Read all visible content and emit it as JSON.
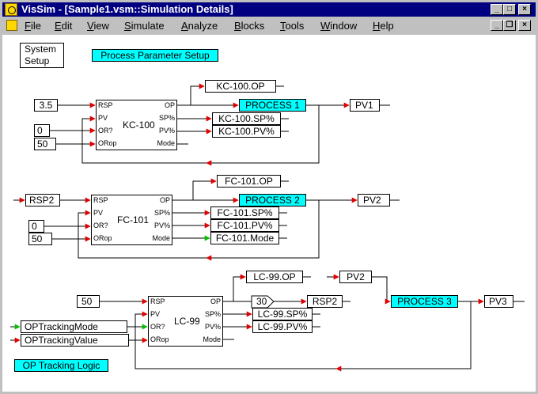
{
  "window": {
    "title": "VisSim - [Sample1.vsm::Simulation Details]",
    "min_glyph": "_",
    "max_glyph": "□",
    "close_glyph": "×",
    "restore_glyph": "❐"
  },
  "menu": [
    "File",
    "Edit",
    "View",
    "Simulate",
    "Analyze",
    "Blocks",
    "Tools",
    "Window",
    "Help"
  ],
  "canvas": {
    "system_setup": "System Setup",
    "process_parameter_setup": "Process Parameter Setup",
    "op_tracking_logic": "OP Tracking Logic",
    "loop1": {
      "rsp_value": "3.5",
      "pv_value": "0",
      "orop_value": "50",
      "block_name": "KC-100",
      "in_ports": [
        "RSP",
        "PV",
        "OR?",
        "ORop"
      ],
      "out_ports": [
        "OP",
        "SP%",
        "PV%",
        "Mode"
      ],
      "op_var": "KC-100.OP",
      "sp_var": "KC-100.SP%",
      "pv_var": "KC-100.PV%",
      "process": "PROCESS 1",
      "pv_out": "PV1"
    },
    "loop2": {
      "rsp_value": "RSP2",
      "pv_value": "0",
      "orop_value": "50",
      "block_name": "FC-101",
      "in_ports": [
        "RSP",
        "PV",
        "OR?",
        "ORop"
      ],
      "out_ports": [
        "OP",
        "SP%",
        "PV%",
        "Mode"
      ],
      "op_var": "FC-101.OP",
      "sp_var": "FC-101.SP%",
      "pv_var": "FC-101.PV%",
      "mode_var": "FC-101.Mode",
      "process": "PROCESS 2",
      "pv_out": "PV2"
    },
    "loop3": {
      "rsp_value": "50",
      "track_mode": "OPTrackingMode",
      "track_value": "OPTrackingValue",
      "block_name": "LC-99",
      "in_ports": [
        "RSP",
        "PV",
        "OR?",
        "ORop"
      ],
      "out_ports": [
        "OP",
        "SP%",
        "PV%",
        "Mode"
      ],
      "op_var": "LC-99.OP",
      "sp_var": "LC-99.SP%",
      "pv_var": "LC-99.PV%",
      "gain": "30",
      "rsp_out": "RSP2",
      "pv_in": "PV2",
      "process": "PROCESS 3",
      "pv_out": "PV3"
    }
  }
}
